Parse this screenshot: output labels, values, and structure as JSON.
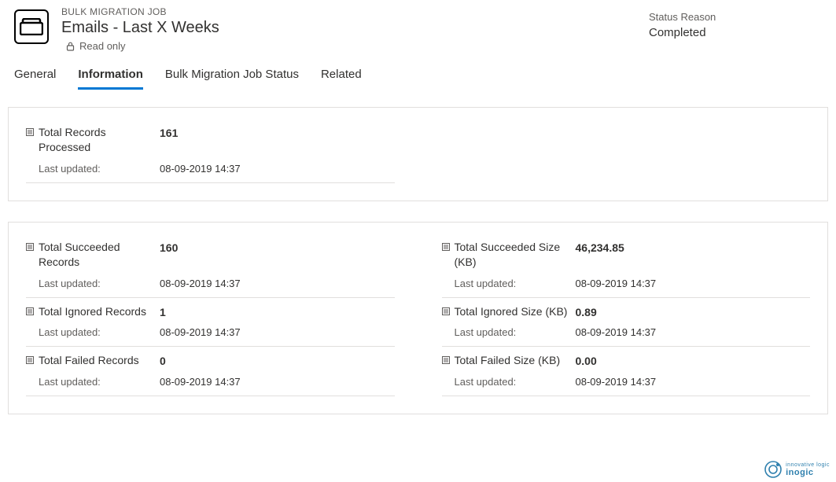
{
  "header": {
    "entity_label": "BULK MIGRATION JOB",
    "title": "Emails - Last X Weeks",
    "readonly_text": "Read only",
    "status_label": "Status Reason",
    "status_value": "Completed"
  },
  "tabs": {
    "general": "General",
    "information": "Information",
    "job_status": "Bulk Migration Job Status",
    "related": "Related"
  },
  "strings": {
    "last_updated_label": "Last updated:"
  },
  "panel1": {
    "processed": {
      "label": "Total Records Processed",
      "value": "161",
      "updated": "08-09-2019 14:37"
    }
  },
  "panel2": {
    "left": {
      "succeeded": {
        "label": "Total Succeeded Records",
        "value": "160",
        "updated": "08-09-2019 14:37"
      },
      "ignored": {
        "label": "Total Ignored Records",
        "value": "1",
        "updated": "08-09-2019 14:37"
      },
      "failed": {
        "label": "Total Failed Records",
        "value": "0",
        "updated": "08-09-2019 14:37"
      }
    },
    "right": {
      "succeeded_size": {
        "label": "Total Succeeded Size (KB)",
        "value": "46,234.85",
        "updated": "08-09-2019 14:37"
      },
      "ignored_size": {
        "label": "Total Ignored Size (KB)",
        "value": "0.89",
        "updated": "08-09-2019 14:37"
      },
      "failed_size": {
        "label": "Total Failed Size (KB)",
        "value": "0.00",
        "updated": "08-09-2019 14:37"
      }
    }
  },
  "watermark": {
    "line1": "innovative logic",
    "line2": "inogic"
  }
}
